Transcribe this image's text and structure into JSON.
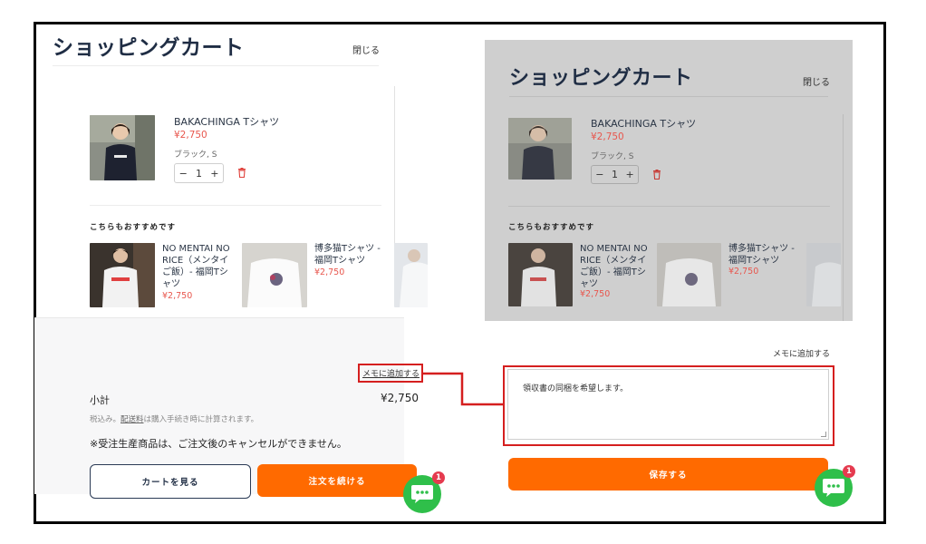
{
  "left_panel": {
    "title": "ショッピングカート",
    "close_label": "閉じる",
    "cart_item": {
      "name": "BAKACHINGA Tシャツ",
      "price": "¥2,750",
      "variant": "ブラック, S",
      "quantity": "1",
      "minus": "−",
      "plus": "+"
    },
    "recommend_heading": "こちらもおすすめです",
    "recommendations": [
      {
        "name": "NO MENTAI NO RICE（メンタイご飯）- 福岡Tシャツ",
        "price": "¥2,750"
      },
      {
        "name": "博多猫Tシャツ - 福岡Tシャツ",
        "price": "¥2,750"
      }
    ],
    "memo_link": "メモに追加する",
    "subtotal_label": "小計",
    "subtotal_value": "¥2,750",
    "tax_note_prefix": "税込み。",
    "tax_note_link": "配送料",
    "tax_note_suffix": "は購入手続き時に計算されます。",
    "notice": "※受注生産商品は、ご注文後のキャンセルができません。",
    "view_cart_button": "カートを見る",
    "checkout_button": "注文を続ける",
    "chat_badge": "1"
  },
  "right_panel": {
    "title": "ショッピングカート",
    "close_label": "閉じる",
    "cart_item": {
      "name": "BAKACHINGA Tシャツ",
      "price": "¥2,750",
      "variant": "ブラック, S",
      "quantity": "1",
      "minus": "−",
      "plus": "+"
    },
    "recommend_heading": "こちらもおすすめです",
    "recommendations": [
      {
        "name": "NO MENTAI NO RICE（メンタイご飯）- 福岡Tシャツ",
        "price": "¥2,750"
      },
      {
        "name": "博多猫Tシャツ - 福岡Tシャツ",
        "price": "¥2,750"
      }
    ],
    "memo_add_label": "メモに追加する",
    "memo_text": "領収書の同梱を希望します。",
    "save_button": "保存する",
    "chat_badge": "1"
  },
  "colors": {
    "accent_orange": "#ff6a00",
    "price_red": "#e8564d",
    "highlight_red": "#d51f1f",
    "chat_green": "#2fbf4a",
    "badge_red": "#e53b4f"
  },
  "icons": [
    "trash-icon",
    "chat-icon",
    "resize-grip-icon"
  ]
}
